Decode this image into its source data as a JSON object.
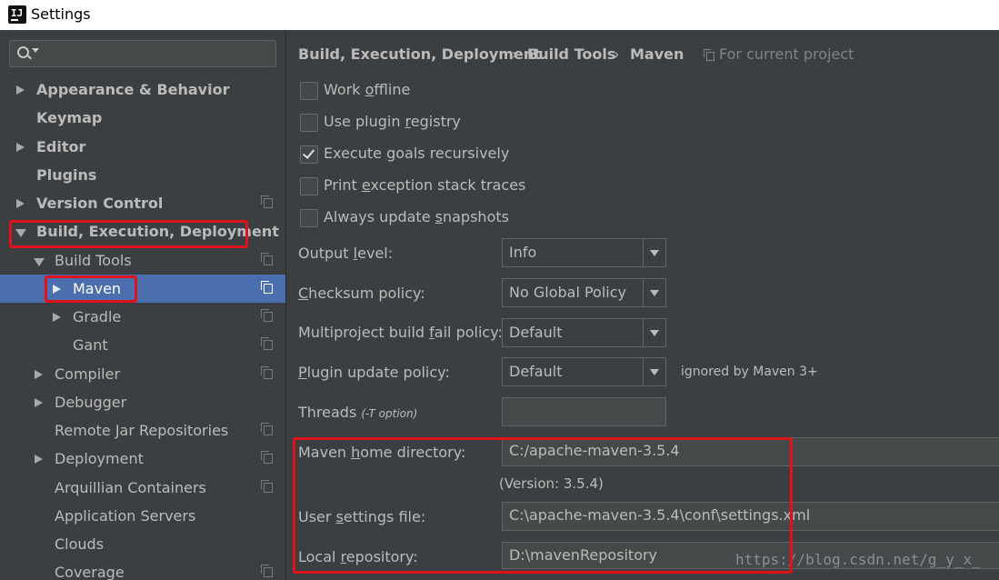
{
  "window": {
    "title": "Settings"
  },
  "search": {
    "placeholder": ""
  },
  "sidebar": {
    "items": [
      {
        "label": "Appearance & Behavior"
      },
      {
        "label": "Keymap"
      },
      {
        "label": "Editor"
      },
      {
        "label": "Plugins"
      },
      {
        "label": "Version Control"
      },
      {
        "label": "Build, Execution, Deployment"
      },
      {
        "label": "Build Tools"
      },
      {
        "label": "Maven"
      },
      {
        "label": "Gradle"
      },
      {
        "label": "Gant"
      },
      {
        "label": "Compiler"
      },
      {
        "label": "Debugger"
      },
      {
        "label": "Remote Jar Repositories"
      },
      {
        "label": "Deployment"
      },
      {
        "label": "Arquillian Containers"
      },
      {
        "label": "Application Servers"
      },
      {
        "label": "Clouds"
      },
      {
        "label": "Coverage"
      }
    ]
  },
  "breadcrumb": {
    "parts": [
      "Build, Execution, Deployment",
      "Build Tools",
      "Maven"
    ],
    "separator": "›",
    "scope": "For current project"
  },
  "checkboxes": [
    {
      "pre": "Work ",
      "u": "o",
      "post": "ffline",
      "checked": false
    },
    {
      "pre": "Use plugin ",
      "u": "r",
      "post": "egistry",
      "checked": false
    },
    {
      "pre": "Execute ",
      "u": "g",
      "post": "oals recursively",
      "checked": true
    },
    {
      "pre": "Print ",
      "u": "e",
      "post": "xception stack traces",
      "checked": false
    },
    {
      "pre": "Always update ",
      "u": "s",
      "post": "napshots",
      "checked": false
    }
  ],
  "form": {
    "output_level": {
      "pre": "Output ",
      "u": "l",
      "post": "evel:",
      "value": "Info"
    },
    "checksum_policy": {
      "pre": "",
      "u": "C",
      "post": "hecksum policy:",
      "value": "No Global Policy"
    },
    "multiproject_policy": {
      "pre": "Multiproject build ",
      "u": "f",
      "post": "ail policy:",
      "value": "Default"
    },
    "plugin_update_policy": {
      "pre": "",
      "u": "P",
      "post": "lugin update policy:",
      "value": "Default",
      "note": "ignored by Maven 3+"
    },
    "threads": {
      "label": "Threads",
      "hint": "(-T option)",
      "value": ""
    },
    "maven_home": {
      "pre": "Maven ",
      "u": "h",
      "post": "ome directory:",
      "value": "C:/apache-maven-3.5.4",
      "version": "(Version: 3.5.4)"
    },
    "user_settings": {
      "pre": "User ",
      "u": "s",
      "post": "ettings file:",
      "value": "C:\\apache-maven-3.5.4\\conf\\settings.xml"
    },
    "local_repository": {
      "pre": "Local ",
      "u": "r",
      "post": "epository:",
      "value": "D:\\mavenRepository"
    }
  },
  "watermark": "https://blog.csdn.net/g_y_x_",
  "colors": {
    "selection": "#4b6eaf",
    "highlight": "#e0121c",
    "background": "#3c3f41"
  }
}
